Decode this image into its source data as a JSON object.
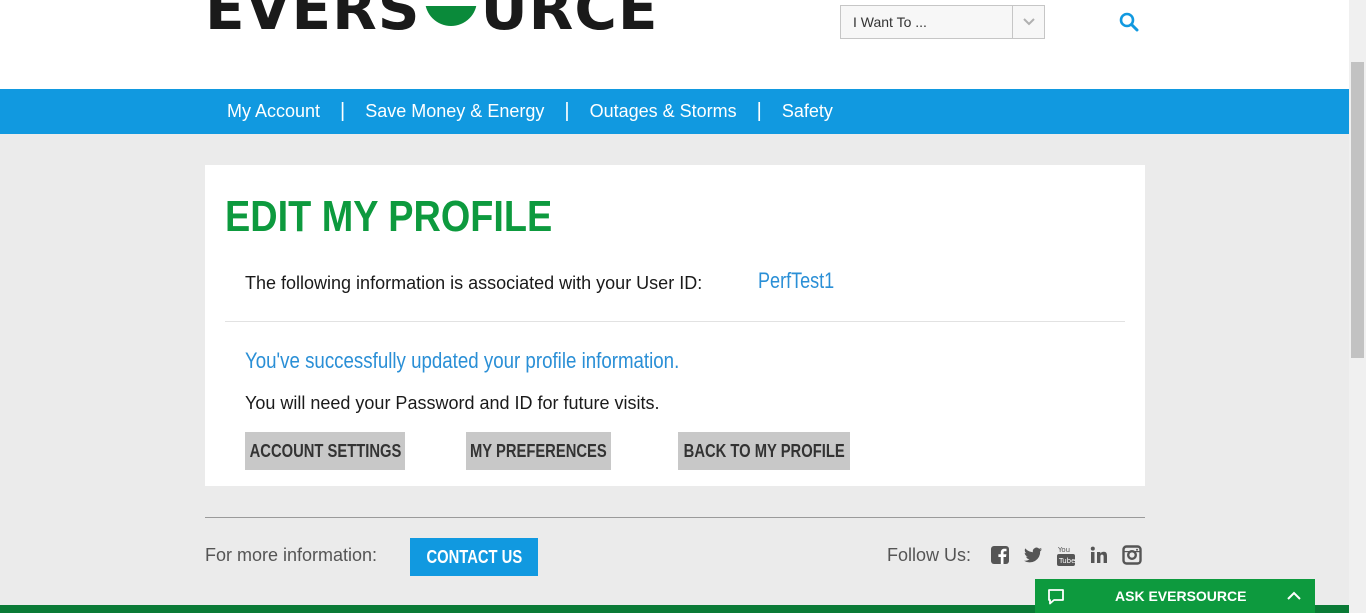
{
  "header": {
    "logo_text_left": "EVERS",
    "logo_text_right": "URCE",
    "i_want_to": "I Want To ...",
    "search_icon": "search-icon"
  },
  "nav": {
    "items": [
      "My Account",
      "Save Money & Energy",
      "Outages & Storms",
      "Safety"
    ],
    "separator": "|"
  },
  "profile": {
    "title": "EDIT MY PROFILE",
    "assoc_label": "The following information is associated with your User ID:",
    "user_id": "PerfTest1",
    "success_message": "You've successfully updated your profile information.",
    "note": "You will need your Password and ID for future visits.",
    "buttons": {
      "account_settings": "ACCOUNT SETTINGS",
      "my_preferences": "MY PREFERENCES",
      "back_to_profile": "BACK TO MY PROFILE"
    }
  },
  "footer": {
    "more_info_label": "For more information:",
    "contact_button": "CONTACT US",
    "follow_label": "Follow Us:",
    "social_icons": [
      "facebook-icon",
      "twitter-icon",
      "youtube-icon",
      "linkedin-icon",
      "instagram-icon"
    ]
  },
  "chat": {
    "label": "ASK EVERSOURCE"
  },
  "colors": {
    "nav_blue": "#1199e0",
    "brand_green": "#0d9a3e",
    "link_blue": "#2a8fd6",
    "button_gray": "#c8c8c8",
    "background": "#ebebeb"
  }
}
